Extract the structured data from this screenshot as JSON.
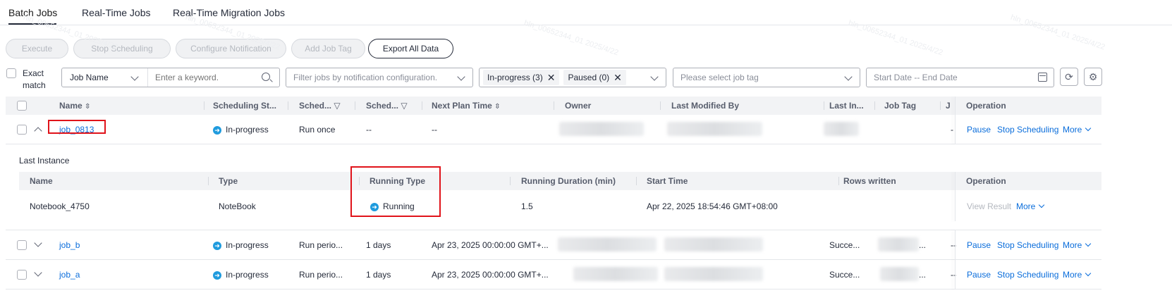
{
  "tabs": [
    {
      "label": "Batch Jobs",
      "active": true
    },
    {
      "label": "Real-Time Jobs",
      "active": false
    },
    {
      "label": "Real-Time Migration Jobs",
      "active": false
    }
  ],
  "toolbar": {
    "execute": "Execute",
    "stop_scheduling": "Stop Scheduling",
    "configure_notification": "Configure Notification",
    "add_job_tag": "Add Job Tag",
    "export_all": "Export All Data"
  },
  "filters": {
    "exact_match": "Exact match",
    "exact_match_line1": "Exact",
    "exact_match_line2": "match",
    "field_select": "Job Name",
    "keyword_placeholder": "Enter a keyword.",
    "notification_placeholder": "Filter jobs by notification configuration.",
    "status_chips": [
      "In-progress (3)",
      "Paused (0)"
    ],
    "tag_placeholder": "Please select job tag",
    "date_placeholder": "Start Date -- End Date"
  },
  "table": {
    "headers": {
      "name": "Name",
      "scheduling_status": "Scheduling St...",
      "sched1": "Sched...",
      "sched2": "Sched...",
      "next_plan_time": "Next Plan Time",
      "owner": "Owner",
      "last_modified_by": "Last Modified By",
      "last_instance": "Last In...",
      "job_tag": "Job Tag",
      "j": "J",
      "operation": "Operation"
    },
    "rows": [
      {
        "name": "job_0813",
        "status": "In-progress",
        "sched1": "Run once",
        "sched2": "--",
        "next_plan": "--",
        "last_instance": "",
        "job_tag": "",
        "j": "",
        "ops": [
          "Pause",
          "Stop Scheduling",
          "More"
        ]
      },
      {
        "name": "job_b",
        "status": "In-progress",
        "sched1": "Run perio...",
        "sched2": "1 days",
        "next_plan": "Apr 23, 2025 00:00:00 GMT+...",
        "last_instance": "Succe...",
        "job_tag": "...",
        "j": "--",
        "ops": [
          "Pause",
          "Stop Scheduling",
          "More"
        ]
      },
      {
        "name": "job_a",
        "status": "In-progress",
        "sched1": "Run perio...",
        "sched2": "1 days",
        "next_plan": "Apr 23, 2025 00:00:00 GMT+...",
        "last_instance": "Succe...",
        "job_tag": "...",
        "j": "--",
        "ops": [
          "Pause",
          "Stop Scheduling",
          "More"
        ]
      }
    ]
  },
  "last_instance": {
    "title": "Last Instance",
    "headers": {
      "name": "Name",
      "type": "Type",
      "running_type": "Running Type",
      "running_duration": "Running Duration (min)",
      "start_time": "Start Time",
      "rows_written": "Rows written",
      "operation": "Operation"
    },
    "row": {
      "name": "Notebook_4750",
      "type": "NoteBook",
      "running_type": "Running",
      "running_duration": "1.5",
      "start_time": "Apr 22, 2025 18:54:46 GMT+08:00",
      "rows_written": "",
      "ops": [
        "View Result",
        "More"
      ]
    }
  },
  "colors": {
    "link": "#0a6ddb",
    "status": "#1f9bde",
    "highlight": "#e0131a"
  }
}
